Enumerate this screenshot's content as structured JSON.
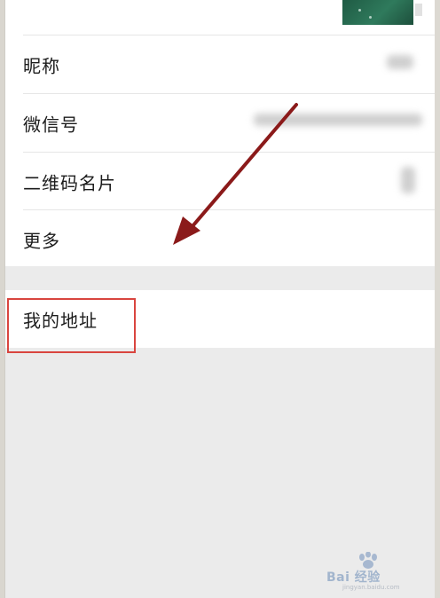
{
  "profile": {
    "items": [
      {
        "label": "昵称"
      },
      {
        "label": "微信号"
      },
      {
        "label": "二维码名片"
      },
      {
        "label": "更多"
      }
    ]
  },
  "address": {
    "label": "我的地址"
  },
  "watermark": {
    "text": "Bai 经验",
    "sub": "jingyan.baidu.com"
  },
  "colors": {
    "highlight": "#d9453f",
    "arrow": "#8b1a1a",
    "page_bg": "#ebebeb",
    "row_bg": "#ffffff",
    "avatar": "#1f5b44"
  },
  "icons": [
    "chevron-right-icon",
    "avatar-image",
    "baidu-paw-icon"
  ]
}
